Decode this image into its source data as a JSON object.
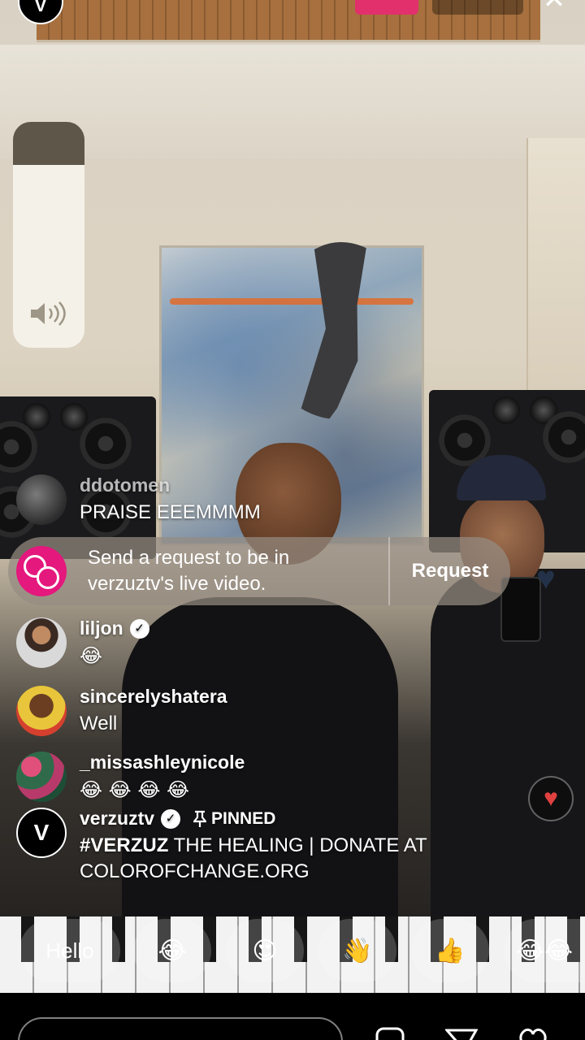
{
  "header": {
    "host_avatar_letter": "V"
  },
  "volume": {
    "level": 0.81
  },
  "comments": [
    {
      "username": "ddotomen",
      "text": "PRAISE EEEMMMM",
      "verified": false
    },
    {
      "username": "liljon",
      "text": "😂",
      "verified": true
    },
    {
      "username": "sincerelyshatera",
      "text": "Well",
      "verified": false
    },
    {
      "username": "_missashleynicole",
      "text": "😂 😂 😂 😂",
      "verified": false
    }
  ],
  "request": {
    "text_line1": "Send a request to be in",
    "text_line2": "verzuztv's live video.",
    "button_label": "Request"
  },
  "pinned": {
    "avatar_letter": "V",
    "username": "verzuztv",
    "tag": "PINNED",
    "hashtag": "#VERZUZ",
    "text_rest": " THE HEALING | DONATE AT",
    "text_line2": "COLOROFCHANGE.ORG"
  },
  "quick_reactions": [
    {
      "label": "Hello",
      "icon": "text"
    },
    {
      "label": "😂",
      "icon": "tears-of-joy-emoji"
    },
    {
      "label": "😍",
      "icon": "heart-eyes-emoji"
    },
    {
      "label": "👋",
      "icon": "waving-hand-emoji"
    },
    {
      "label": "👍",
      "icon": "thumbs-up-emoji"
    },
    {
      "label": "😂😂",
      "icon": "tears-of-joy-emoji"
    }
  ],
  "colors": {
    "live_pink": "#e1306c",
    "request_icon": "#e4187d",
    "heart_red": "#e0413f"
  },
  "icons": {
    "close": "close-icon",
    "volume": "speaker-volume-icon",
    "heart": "heart-icon",
    "pin": "pin-icon",
    "verified": "verified-badge-icon",
    "request": "add-guest-icon"
  }
}
